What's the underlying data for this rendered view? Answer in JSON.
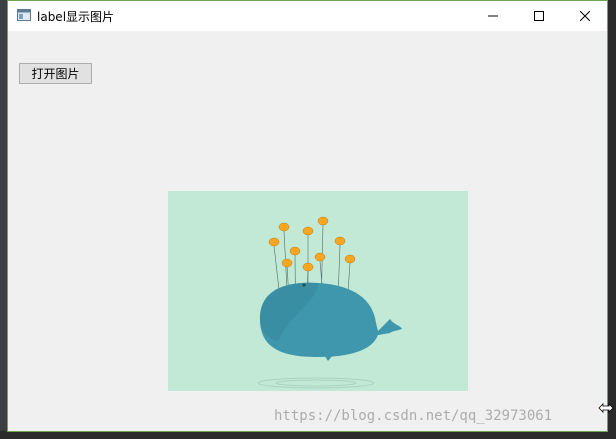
{
  "window": {
    "title": "label显示图片",
    "controls": {
      "minimize_icon": "minimize-icon",
      "maximize_icon": "maximize-icon",
      "close_icon": "close-icon"
    }
  },
  "main": {
    "open_button_label": "打开图片",
    "image_description_icon": "whale-with-birds-image"
  },
  "overlay": {
    "watermark": "https://blog.csdn.net/qq_32973061"
  },
  "colors": {
    "window_bg": "#f0f0f0",
    "titlebar_bg": "#ffffff",
    "image_bg": "#c2e8d6",
    "whale": "#3f97ad",
    "bird": "#f5a623"
  }
}
